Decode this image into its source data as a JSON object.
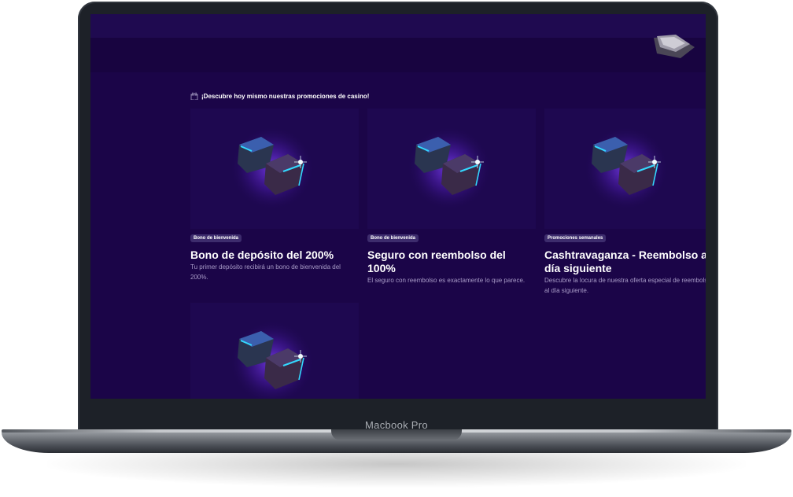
{
  "device": {
    "label": "Macbook Pro"
  },
  "section": {
    "title": "¡Descubre hoy mismo nuestras promociones de casino!",
    "icon": "gift-icon"
  },
  "promotions": [
    {
      "badge": "Bono de bienvenida",
      "title": "Bono de depósito del 200%",
      "description": "Tu primer depósito recibirá un bono de bienvenida del 200%."
    },
    {
      "badge": "Bono de bienvenida",
      "title": "Seguro con reembolso del 100%",
      "description": "El seguro con reembolso es exactamente lo que parece."
    },
    {
      "badge": "Promociones semanales",
      "title": "Cashtravaganza - Reembolso a día siguiente",
      "description": "Descubre la locura de nuestra oferta especial de reembolso al día siguiente."
    }
  ],
  "colors": {
    "screen_bg": "#1b0548",
    "card_bg": "#1e0850",
    "badge_bg": "#3d2c6d",
    "accent_cyan": "#33d8ff",
    "accent_purple": "#7b3ff2"
  }
}
